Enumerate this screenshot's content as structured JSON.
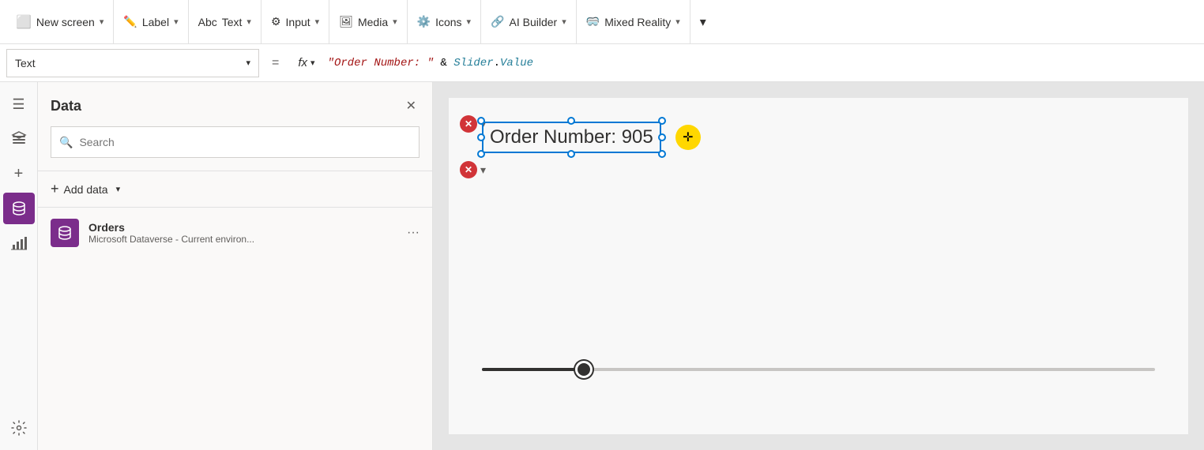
{
  "toolbar": {
    "new_screen_label": "New screen",
    "label_label": "Label",
    "text_label": "Text",
    "input_label": "Input",
    "media_label": "Media",
    "icons_label": "Icons",
    "ai_builder_label": "AI Builder",
    "mixed_reality_label": "Mixed Reality"
  },
  "formula_bar": {
    "dropdown_label": "Text",
    "equals": "=",
    "fx_label": "fx",
    "formula": "\"Order Number: \" & Slider.Value"
  },
  "data_panel": {
    "title": "Data",
    "search_placeholder": "Search",
    "add_data_label": "Add data",
    "sources": [
      {
        "name": "Orders",
        "subtitle": "Microsoft Dataverse - Current environ..."
      }
    ]
  },
  "canvas": {
    "text_element": "Order Number: 905",
    "slider_value": 905
  },
  "icons": {
    "hamburger": "☰",
    "layers": "⊞",
    "add": "+",
    "database": "🗄",
    "chart": "📊",
    "settings": "⚙"
  }
}
